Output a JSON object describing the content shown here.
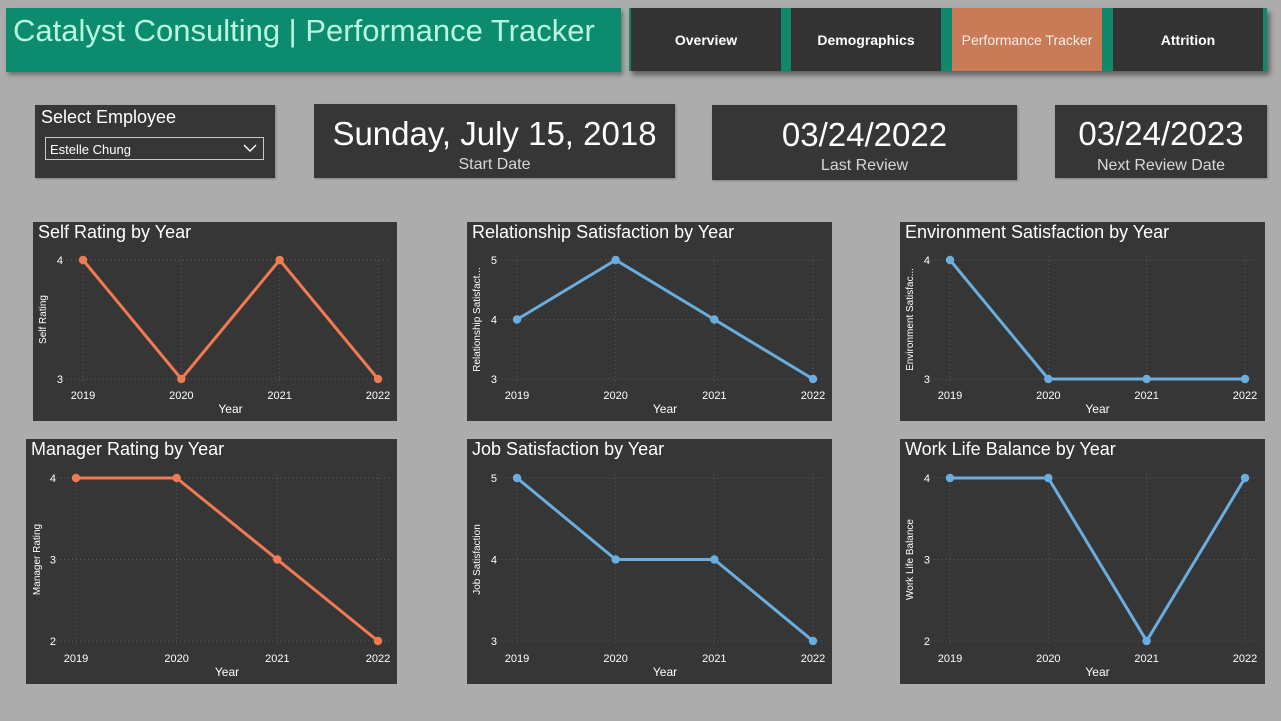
{
  "header": {
    "title": "Catalyst Consulting | Performance Tracker"
  },
  "nav": {
    "buttons": [
      {
        "label": "Overview",
        "active": false
      },
      {
        "label": "Demographics",
        "active": false
      },
      {
        "label": "Performance Tracker",
        "active": true
      },
      {
        "label": "Attrition",
        "active": false
      }
    ]
  },
  "slicer": {
    "label": "Select Employee",
    "value": "Estelle Chung",
    "icon": "chevron-down-icon"
  },
  "cards": {
    "start_date": {
      "value": "Sunday, July 15, 2018",
      "label": "Start Date"
    },
    "last_review": {
      "value": "03/24/2022",
      "label": "Last Review"
    },
    "next_review": {
      "value": "03/24/2023",
      "label": "Next Review Date"
    }
  },
  "colors": {
    "orange_series": "#f07a52",
    "blue_series": "#6aaee0",
    "accent_teal": "#0d8b6e",
    "active_tab": "#c97a56"
  },
  "chart_data": [
    {
      "id": "self",
      "type": "line",
      "title": "Self Rating by Year",
      "xlabel": "Year",
      "ylabel": "Self Rating",
      "categories": [
        "2019",
        "2020",
        "2021",
        "2022"
      ],
      "values": [
        4,
        3,
        4,
        3
      ],
      "ylim": [
        3,
        4
      ],
      "yticks": [
        3,
        4
      ],
      "color": "#f07a52",
      "grid": true
    },
    {
      "id": "relationship",
      "type": "line",
      "title": "Relationship Satisfaction by Year",
      "xlabel": "Year",
      "ylabel": "Relationship Satisfact...",
      "categories": [
        "2019",
        "2020",
        "2021",
        "2022"
      ],
      "values": [
        4,
        5,
        4,
        3
      ],
      "ylim": [
        3,
        5
      ],
      "yticks": [
        3,
        4,
        5
      ],
      "color": "#6aaee0",
      "grid": true
    },
    {
      "id": "environment",
      "type": "line",
      "title": "Environment Satisfaction by Year",
      "xlabel": "Year",
      "ylabel": "Environment Satisfac...",
      "categories": [
        "2019",
        "2020",
        "2021",
        "2022"
      ],
      "values": [
        4,
        3,
        3,
        3
      ],
      "ylim": [
        3,
        4
      ],
      "yticks": [
        3,
        4
      ],
      "color": "#6aaee0",
      "grid": true
    },
    {
      "id": "manager",
      "type": "line",
      "title": "Manager Rating by Year",
      "xlabel": "Year",
      "ylabel": "Manager Rating",
      "categories": [
        "2019",
        "2020",
        "2021",
        "2022"
      ],
      "values": [
        4,
        4,
        3,
        2
      ],
      "ylim": [
        2,
        4
      ],
      "yticks": [
        2,
        3,
        4
      ],
      "color": "#f07a52",
      "grid": true
    },
    {
      "id": "job",
      "type": "line",
      "title": "Job Satisfaction by Year",
      "xlabel": "Year",
      "ylabel": "Job Satisfaction",
      "categories": [
        "2019",
        "2020",
        "2021",
        "2022"
      ],
      "values": [
        5,
        4,
        4,
        3
      ],
      "ylim": [
        3,
        5
      ],
      "yticks": [
        3,
        4,
        5
      ],
      "color": "#6aaee0",
      "grid": true
    },
    {
      "id": "worklife",
      "type": "line",
      "title": "Work Life Balance by Year",
      "xlabel": "Year",
      "ylabel": "Work Life Balance",
      "categories": [
        "2019",
        "2020",
        "2021",
        "2022"
      ],
      "values": [
        4,
        4,
        2,
        4
      ],
      "ylim": [
        2,
        4
      ],
      "yticks": [
        2,
        3,
        4
      ],
      "color": "#6aaee0",
      "grid": true
    }
  ]
}
